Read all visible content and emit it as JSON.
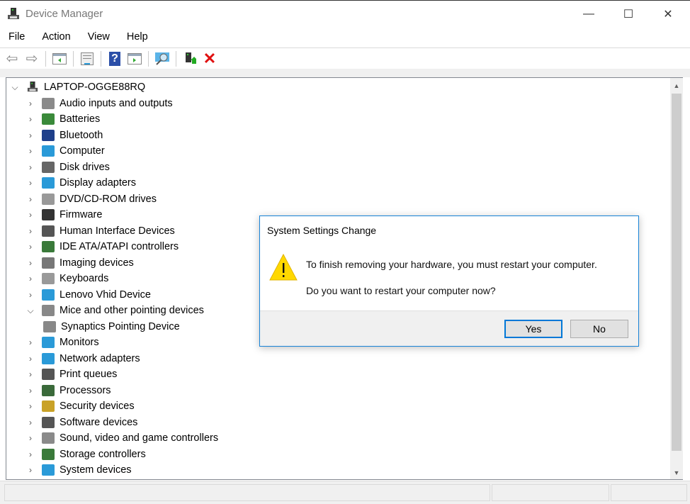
{
  "window": {
    "title": "Device Manager",
    "minimize": "—",
    "maximize": "☐",
    "close": "✕"
  },
  "menu": [
    "File",
    "Action",
    "View",
    "Help"
  ],
  "toolbar": {
    "icons": [
      "back-arrow-icon",
      "forward-arrow-icon",
      "show-hide-console-tree-icon",
      "properties-icon",
      "help-icon",
      "show-action-pane-icon",
      "scan-hardware-icon",
      "update-driver-icon",
      "uninstall-device-icon"
    ]
  },
  "tree": {
    "root": "LAPTOP-OGGE88RQ",
    "items": [
      {
        "label": "Audio inputs and outputs",
        "color": "#8a8a8a"
      },
      {
        "label": "Batteries",
        "color": "#3a8a3a"
      },
      {
        "label": "Bluetooth",
        "color": "#1e3f8a"
      },
      {
        "label": "Computer",
        "color": "#2a9ad8"
      },
      {
        "label": "Disk drives",
        "color": "#666666"
      },
      {
        "label": "Display adapters",
        "color": "#2a9ad8"
      },
      {
        "label": "DVD/CD-ROM drives",
        "color": "#999999"
      },
      {
        "label": "Firmware",
        "color": "#333333"
      },
      {
        "label": "Human Interface Devices",
        "color": "#555555"
      },
      {
        "label": "IDE ATA/ATAPI controllers",
        "color": "#3a7a3a"
      },
      {
        "label": "Imaging devices",
        "color": "#777777"
      },
      {
        "label": "Keyboards",
        "color": "#999999"
      },
      {
        "label": "Lenovo Vhid Device",
        "color": "#2a9ad8"
      },
      {
        "label": "Mice and other pointing devices",
        "color": "#888888",
        "expanded": true
      },
      {
        "label": "Synaptics Pointing Device",
        "color": "#888888",
        "child": true
      },
      {
        "label": "Monitors",
        "color": "#2a9ad8"
      },
      {
        "label": "Network adapters",
        "color": "#2a9ad8"
      },
      {
        "label": "Print queues",
        "color": "#555555"
      },
      {
        "label": "Processors",
        "color": "#3a6a3a"
      },
      {
        "label": "Security devices",
        "color": "#c9a227"
      },
      {
        "label": "Software devices",
        "color": "#555555"
      },
      {
        "label": "Sound, video and game controllers",
        "color": "#8a8a8a"
      },
      {
        "label": "Storage controllers",
        "color": "#3a7a3a"
      },
      {
        "label": "System devices",
        "color": "#2a9ad8"
      }
    ]
  },
  "dialog": {
    "title": "System Settings Change",
    "message": "To finish removing your hardware, you must restart your computer.",
    "question": "Do you want to restart your computer now?",
    "yes": "Yes",
    "no": "No"
  }
}
